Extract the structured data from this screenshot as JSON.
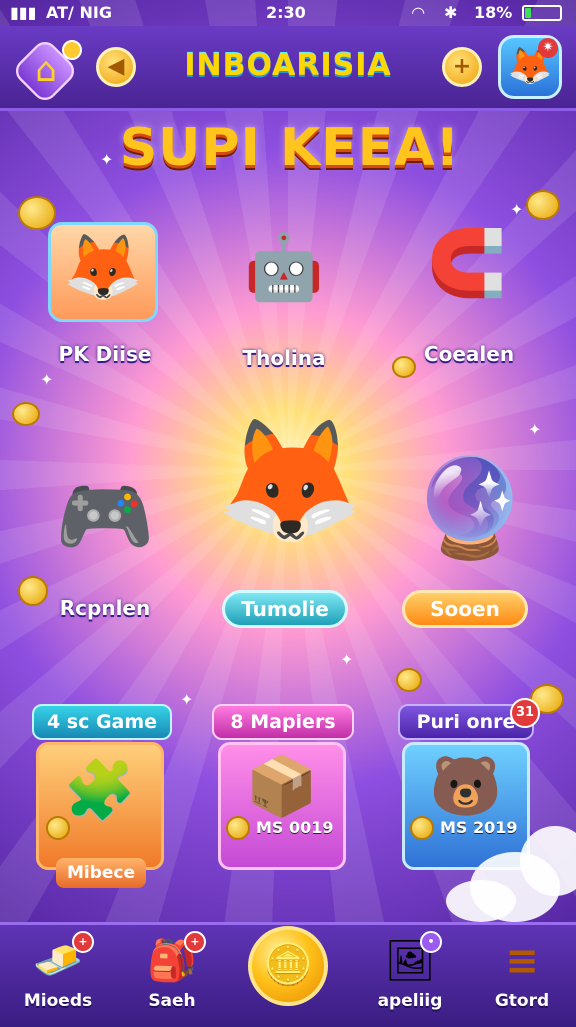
{
  "status_bar": {
    "signal": "▮▮▮",
    "carrier": "AT/ NIG",
    "time": "2:30",
    "wifi": "◠",
    "bluetooth": "✱",
    "battery_pct": "18%",
    "battery_level": 0.18
  },
  "header": {
    "title": "INBOARISIA",
    "home_icon": "⌂",
    "back_icon": "◀",
    "add_icon": "+",
    "avatar_icon": "🦊",
    "avatar_badge_icon": "✷"
  },
  "banner": {
    "text": "SUPI KEEA!"
  },
  "items": [
    {
      "label": "PK Diise",
      "icon": "🦊"
    },
    {
      "label": "Tholina",
      "icon": "🤖"
    },
    {
      "label": "Coealen",
      "icon": "🧲"
    },
    {
      "label": "Rcpnlen",
      "icon": "🎮"
    },
    {
      "label": "Tumolie",
      "icon": "🦊"
    },
    {
      "label": "Sooen",
      "icon": "🔮"
    }
  ],
  "modes": [
    {
      "tab": "4 sc Game",
      "price": "",
      "icon": "🧩",
      "footer": "Mibece"
    },
    {
      "tab": "8 Mapiers",
      "price": "MS 0019",
      "icon": "📦"
    },
    {
      "tab": "Puri onre",
      "price": "MS 2019",
      "icon": "🐻",
      "badge": "31"
    }
  ],
  "bottom_nav": [
    {
      "label": "Mioeds",
      "icon": "🧈",
      "badge": "+"
    },
    {
      "label": "Saeh",
      "icon": "🎒",
      "badge": "+"
    },
    {
      "label": "",
      "icon": "🪙"
    },
    {
      "label": "apeliig",
      "icon": "🖼",
      "badge": "•"
    },
    {
      "label": "Gtord",
      "icon": "≡"
    }
  ],
  "colors": {
    "header_bg": "#5a2bb0",
    "title_gold": "#ffd700",
    "banner_gold": "#ffc51c",
    "teal_btn": "#2fb8c9",
    "orange_btn": "#ff9c1f",
    "badge_red": "#e23a3a"
  }
}
